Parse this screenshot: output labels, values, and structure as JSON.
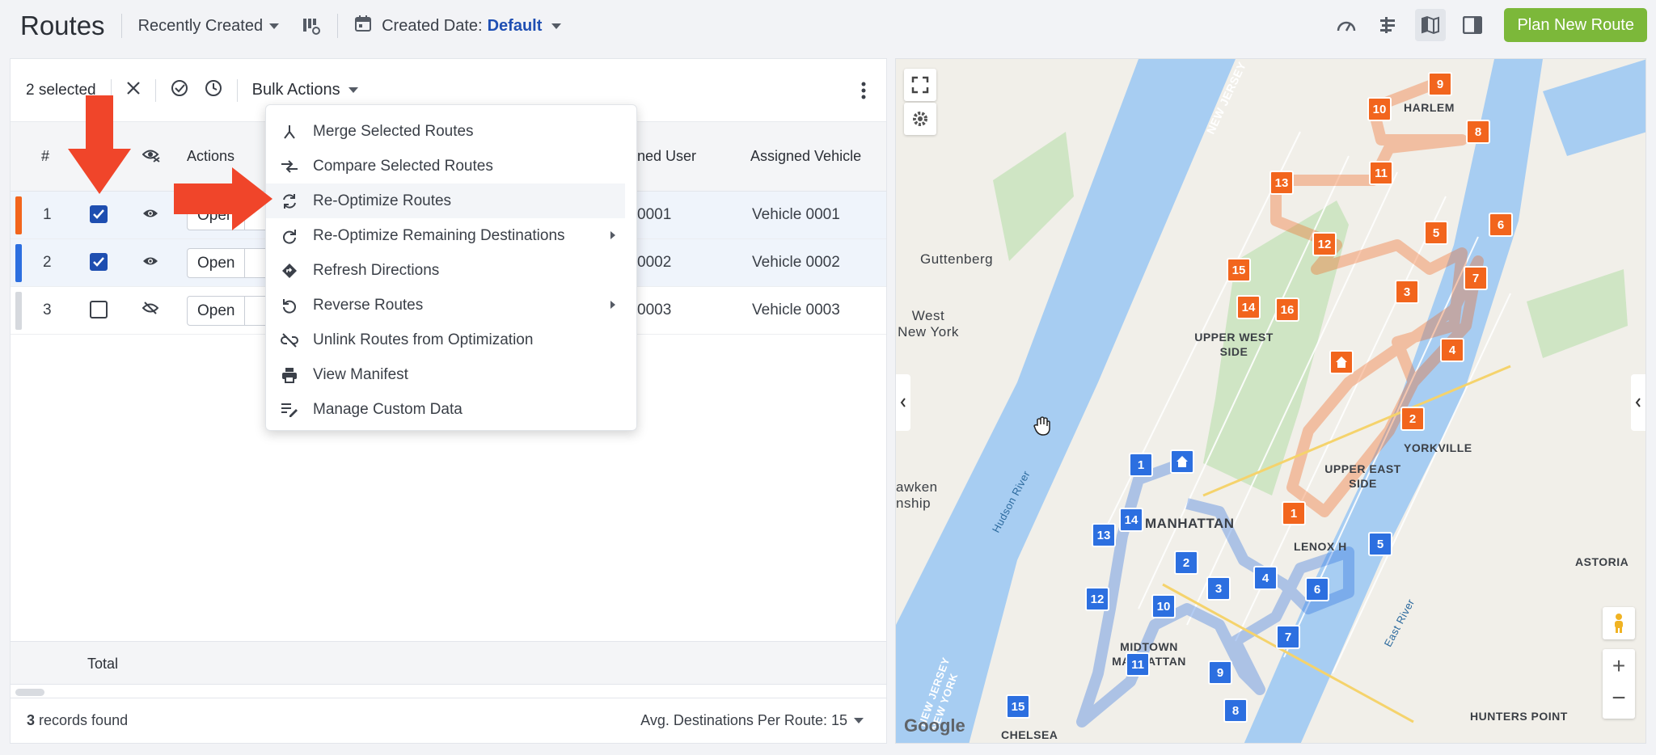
{
  "header": {
    "title": "Routes",
    "sort_label": "Recently Created",
    "date_filter_label": "Created Date:",
    "date_filter_value": "Default",
    "plan_button": "Plan New Route"
  },
  "selection_bar": {
    "selected_text": "2 selected",
    "bulk_actions_label": "Bulk Actions"
  },
  "table": {
    "columns": {
      "index": "#",
      "actions": "Actions",
      "assigned_user": "ned User",
      "assigned_vehicle": "Assigned Vehicle"
    },
    "rows": [
      {
        "num": "1",
        "checked": true,
        "visible": true,
        "action": "Open",
        "user": "0001",
        "vehicle": "Vehicle 0001",
        "color": "#f2651d"
      },
      {
        "num": "2",
        "checked": true,
        "visible": true,
        "action": "Open",
        "user": "0002",
        "vehicle": "Vehicle 0002",
        "color": "#2c6fe0"
      },
      {
        "num": "3",
        "checked": false,
        "visible": false,
        "action": "Open",
        "user": "0003",
        "vehicle": "Vehicle 0003",
        "color": "#d6d9de"
      }
    ],
    "total_label": "Total"
  },
  "footer": {
    "records_count": "3",
    "records_text": "records found",
    "avg_label": "Avg. Destinations Per Route: 15"
  },
  "bulk_menu": {
    "items": [
      {
        "label": "Merge Selected Routes",
        "icon": "merge-icon"
      },
      {
        "label": "Compare Selected Routes",
        "icon": "compare-icon"
      },
      {
        "label": "Re-Optimize Routes",
        "icon": "reoptimize-icon"
      },
      {
        "label": "Re-Optimize Remaining Destinations",
        "icon": "reoptimize-remaining-icon"
      },
      {
        "label": "Refresh Directions",
        "icon": "directions-icon"
      },
      {
        "label": "Reverse Routes",
        "icon": "reverse-icon"
      },
      {
        "label": "Unlink Routes from Optimization",
        "icon": "unlink-icon"
      },
      {
        "label": "View Manifest",
        "icon": "print-icon"
      },
      {
        "label": "Manage Custom Data",
        "icon": "custom-data-icon"
      }
    ]
  },
  "map": {
    "labels": {
      "guttenberg": "Guttenberg",
      "west_new_york": "West New York",
      "upper_west_side": "UPPER WEST SIDE",
      "harlem": "HARLEM",
      "manhattan": "MANHATTAN",
      "upper_east_side": "UPPER EAST SIDE",
      "yorkville": "YORKVILLE",
      "lenox_hill": "LENOX H",
      "midtown": "MIDTOWN MANHATTAN",
      "astoria": "ASTORIA",
      "hunters_point": "HUNTERS POINT",
      "chelsea": "CHELSEA",
      "hoboken": "awken nship",
      "new_jersey": "NEW JERSEY",
      "nj_ny": "NEW JERSEY NEW YORK",
      "hudson_river": "Hudson River",
      "east_river": "East River",
      "google": "Google"
    },
    "orange_stops": [
      "9",
      "10",
      "8",
      "11",
      "13",
      "12",
      "5",
      "6",
      "15",
      "3",
      "7",
      "14",
      "16",
      "4",
      "2",
      "1"
    ],
    "blue_stops": [
      "1",
      "14",
      "13",
      "2",
      "4",
      "5",
      "3",
      "6",
      "12",
      "10",
      "7",
      "11",
      "9",
      "15",
      "8"
    ],
    "colors": {
      "route1": "#f2651d",
      "route2": "#2c6fe0",
      "water": "#a7cdf2",
      "land": "#f1efe9",
      "park": "#cfe5c4"
    }
  }
}
